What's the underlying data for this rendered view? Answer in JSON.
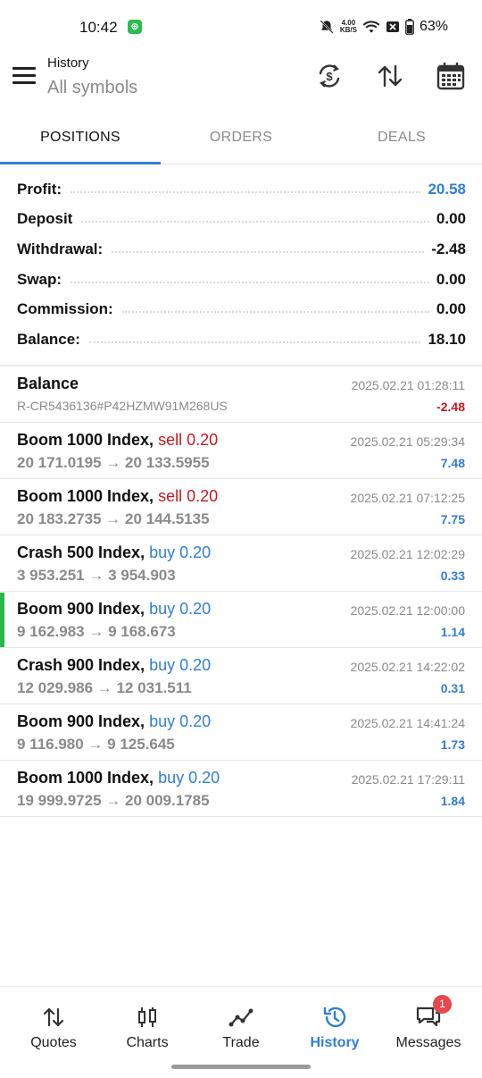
{
  "status_bar": {
    "time": "10:42",
    "net_speed_value": "4.00",
    "net_speed_unit": "KB/S",
    "battery": "63%"
  },
  "header": {
    "title": "History",
    "subtitle": "All symbols",
    "icons": [
      "currency-refresh-icon",
      "sort-icon",
      "calendar-icon"
    ]
  },
  "tabs": [
    {
      "label": "POSITIONS",
      "active": true
    },
    {
      "label": "ORDERS",
      "active": false
    },
    {
      "label": "DEALS",
      "active": false
    }
  ],
  "summary": [
    {
      "label": "Profit:",
      "value": "20.58",
      "color": "#2f7fd3"
    },
    {
      "label": "Deposit",
      "value": "0.00"
    },
    {
      "label": "Withdrawal:",
      "value": "-2.48"
    },
    {
      "label": "Swap:",
      "value": "0.00"
    },
    {
      "label": "Commission:",
      "value": "0.00"
    },
    {
      "label": "Balance:",
      "value": "18.10"
    }
  ],
  "deals": [
    {
      "symbol": "Balance",
      "side": "",
      "prices": "R-CR5436136#P42HZMW91M268US",
      "time": "2025.02.21 01:28:11",
      "profit": "-2.48"
    },
    {
      "symbol": "Boom 1000 Index,",
      "side": "sell 0.20",
      "prices": "20 171.0195 → 20 133.5955",
      "time": "2025.02.21 05:29:34",
      "profit": "7.48"
    },
    {
      "symbol": "Boom 1000 Index,",
      "side": "sell 0.20",
      "prices": "20 183.2735 → 20 144.5135",
      "time": "2025.02.21 07:12:25",
      "profit": "7.75"
    },
    {
      "symbol": "Crash 500 Index,",
      "side": "buy 0.20",
      "prices": "3 953.251 → 3 954.903",
      "time": "2025.02.21 12:02:29",
      "profit": "0.33"
    },
    {
      "symbol": "Boom 900 Index,",
      "side": "buy 0.20",
      "prices": "9 162.983 → 9 168.673",
      "time": "2025.02.21 12:00:00",
      "profit": "1.14"
    },
    {
      "symbol": "Crash 900 Index,",
      "side": "buy 0.20",
      "prices": "12 029.986 → 12 031.511",
      "time": "2025.02.21 14:22:02",
      "profit": "0.31"
    },
    {
      "symbol": "Boom 900 Index,",
      "side": "buy 0.20",
      "prices": "9 116.980 → 9 125.645",
      "time": "2025.02.21 14:41:24",
      "profit": "1.73"
    },
    {
      "symbol": "Boom 1000 Index,",
      "side": "buy 0.20",
      "prices": "19 999.9725 → 20 009.1785",
      "time": "2025.02.21 17:29:11",
      "profit": "1.84"
    }
  ],
  "bottom_nav": [
    {
      "label": "Quotes",
      "icon": "quotes-icon"
    },
    {
      "label": "Charts",
      "icon": "charts-icon"
    },
    {
      "label": "Trade",
      "icon": "trade-icon"
    },
    {
      "label": "History",
      "icon": "history-icon",
      "active": true
    },
    {
      "label": "Messages",
      "icon": "messages-icon",
      "badge": "1"
    }
  ],
  "colors": {
    "accent": "#2f7fd3",
    "sell": "#c8171e",
    "buy": "#2f7fd3",
    "marker": "#2bb84a",
    "badge": "#e5484d"
  }
}
